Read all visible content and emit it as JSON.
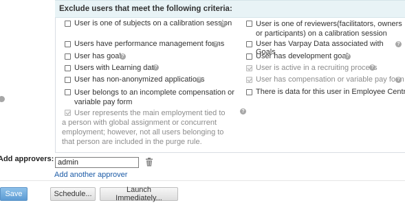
{
  "criteria": {
    "header": "Exclude users that meet the following criteria:",
    "help_glyph": "?",
    "items": [
      {
        "label": "User is one of subjects on a calibration session"
      },
      {
        "label": "User is one of reviewers(facilitators, owners or participants) on a calibration session"
      },
      {
        "label": "Users have performance management forms"
      },
      {
        "label": "User has Varpay Data associated with Goals"
      },
      {
        "label": "User has goal"
      },
      {
        "label": "User has development goal"
      },
      {
        "label": "Users with Learning data"
      },
      {
        "label": "User is active in a recruiting process"
      },
      {
        "label": "User has non-anonymized applications"
      },
      {
        "label": "User has compensation or variable pay form"
      },
      {
        "label": "User belongs to an incomplete compensation or variable pay form"
      },
      {
        "label": "There is data for this user in Employee Central (E"
      },
      {
        "label": "User represents the main employment tied to a person with global assignment or concurrent employment; however, not all users belonging to that person are included in the purge rule."
      }
    ]
  },
  "approvers": {
    "label": "Add approvers:",
    "value": "admin",
    "add_link": "Add another approver"
  },
  "actions": {
    "save": "Save",
    "schedule": "Schedule...",
    "launch": "Launch Immediately..."
  },
  "colors": {
    "header_bg": "#e8f3f6",
    "link": "#1a5aa6",
    "primary_button": "#5c9bd3"
  }
}
